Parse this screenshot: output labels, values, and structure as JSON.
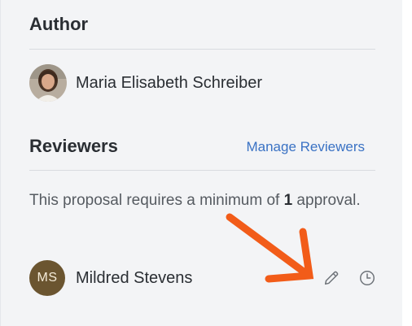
{
  "author": {
    "heading": "Author",
    "name": "Maria Elisabeth Schreiber",
    "avatar_icon": "user-photo"
  },
  "reviewers": {
    "heading": "Reviewers",
    "manage_label": "Manage Reviewers",
    "requirement_prefix": "This proposal requires a minimum of ",
    "requirement_count": "1",
    "requirement_suffix": " approval.",
    "items": [
      {
        "initials": "MS",
        "name": "Mildred Stevens",
        "avatar_color": "#6b5530",
        "actions": [
          "pencil-icon",
          "clock-icon"
        ]
      }
    ]
  },
  "colors": {
    "panel_background": "#f3f4f6",
    "link": "#3a72c4",
    "annotation_arrow": "#f25c19"
  }
}
